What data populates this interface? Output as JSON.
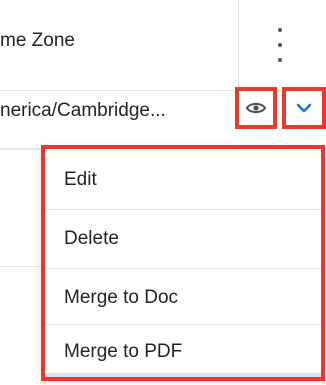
{
  "header": {
    "column_label": "me Zone",
    "more_icon": "vertical-dots-icon"
  },
  "row": {
    "time_zone": "nerica/Cambridge...",
    "preview_icon": "eye-icon",
    "actions_icon": "chevron-down-icon"
  },
  "menu": {
    "items": [
      {
        "label": "Edit"
      },
      {
        "label": "Delete"
      },
      {
        "label": "Merge to Doc"
      },
      {
        "label": "Merge to PDF"
      }
    ]
  },
  "colors": {
    "highlight": "#e8392b",
    "accent": "#1a73c7",
    "icon": "#4a4f56"
  }
}
